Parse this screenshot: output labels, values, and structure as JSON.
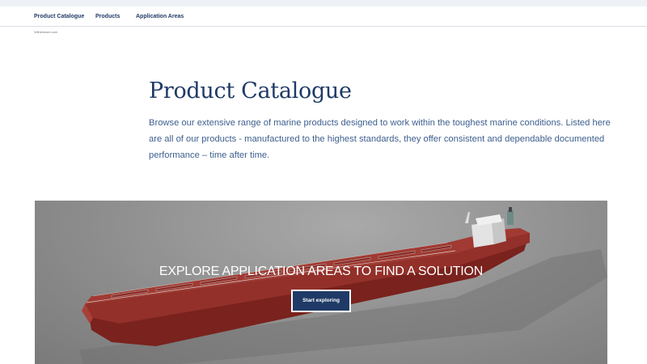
{
  "subnav": {
    "items": [
      {
        "label": "Product Catalogue"
      },
      {
        "label": "Products"
      },
      {
        "label": "Application Areas"
      }
    ]
  },
  "breadcrumb": "Wilhelmsen.com",
  "page": {
    "title": "Product Catalogue",
    "intro": "Browse our extensive range of marine products designed to work within the toughest marine conditions. Listed here are all of our products - manufactured to the highest standards, they offer consistent and dependable documented performance – time after time."
  },
  "hero": {
    "heading": "EXPLORE APPLICATION AREAS TO FIND A SOLUTION",
    "button_label": "Start exploring",
    "image_subject": "cargo-ship-render"
  },
  "colors": {
    "brand_navy": "#1f3a66",
    "intro_text": "#3d5f8e",
    "hull_red": "#8f2a24"
  }
}
